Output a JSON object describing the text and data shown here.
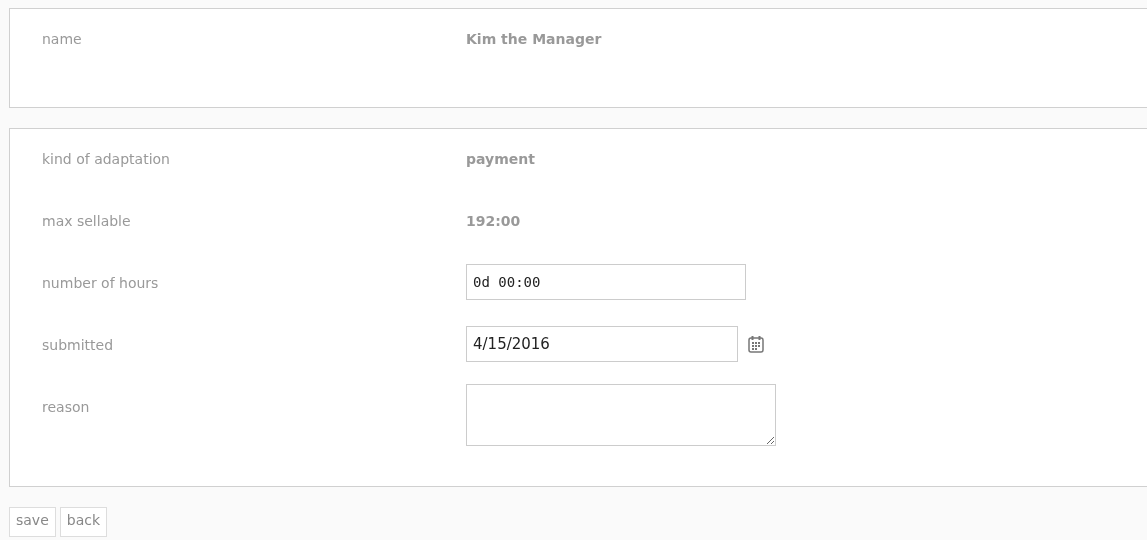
{
  "panels": [
    {
      "rows": [
        {
          "label": "name",
          "kind": "text",
          "value": "Kim the Manager"
        }
      ]
    },
    {
      "rows": [
        {
          "label": "kind of adaptation",
          "kind": "text",
          "value": "payment"
        },
        {
          "label": "max sellable",
          "kind": "text",
          "value": "192:00"
        },
        {
          "label": "number of hours",
          "kind": "input",
          "value": "0d 00:00"
        },
        {
          "label": "submitted",
          "kind": "date",
          "value": "4/15/2016"
        },
        {
          "label": "reason",
          "kind": "textarea"
        }
      ]
    }
  ],
  "buttons": [
    "save",
    "back"
  ]
}
